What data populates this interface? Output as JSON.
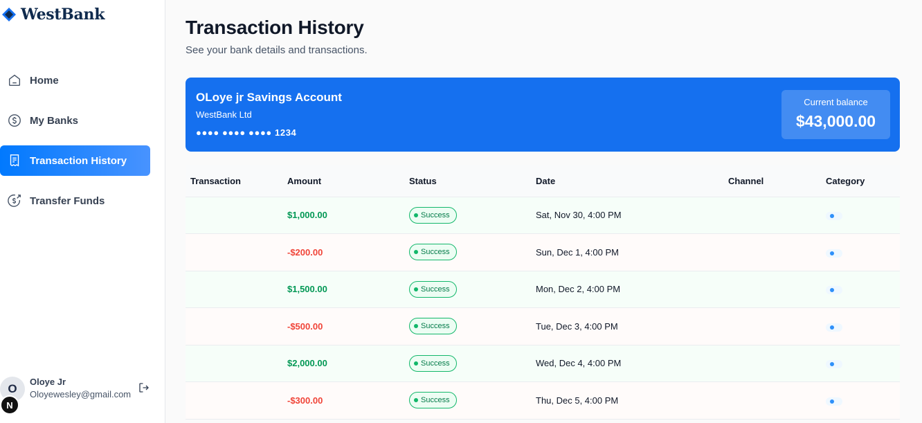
{
  "brand": {
    "name": "WestBank",
    "color": "#0f2a4d"
  },
  "sidebar": {
    "items": [
      {
        "label": "Home",
        "icon": "home-icon",
        "active": false
      },
      {
        "label": "My Banks",
        "icon": "dollar-circle-icon",
        "active": false
      },
      {
        "label": "Transaction History",
        "icon": "receipt-icon",
        "active": true
      },
      {
        "label": "Transfer Funds",
        "icon": "money-send-icon",
        "active": false
      }
    ],
    "user": {
      "initial": "O",
      "badge": "N",
      "name": "Oloye Jr",
      "email": "Oloyewesley@gmail.com"
    }
  },
  "header": {
    "title": "Transaction History",
    "subtitle": "See your bank details and transactions."
  },
  "account": {
    "name": "OLoye jr Savings Account",
    "bank": "WestBank Ltd",
    "mask": "●●●● ●●●● ●●●● 1234",
    "balance_label": "Current balance",
    "balance": "$43,000.00",
    "color": "#1570ef"
  },
  "table": {
    "headers": {
      "transaction": "Transaction",
      "amount": "Amount",
      "status": "Status",
      "date": "Date",
      "channel": "Channel",
      "category": "Category"
    },
    "rows": [
      {
        "transaction": "",
        "amount": "$1,000.00",
        "type": "credit",
        "status": "Success",
        "date": "Sat, Nov 30, 4:00 PM",
        "channel": ""
      },
      {
        "transaction": "",
        "amount": "-$200.00",
        "type": "debit",
        "status": "Success",
        "date": "Sun, Dec 1, 4:00 PM",
        "channel": ""
      },
      {
        "transaction": "",
        "amount": "$1,500.00",
        "type": "credit",
        "status": "Success",
        "date": "Mon, Dec 2, 4:00 PM",
        "channel": ""
      },
      {
        "transaction": "",
        "amount": "-$500.00",
        "type": "debit",
        "status": "Success",
        "date": "Tue, Dec 3, 4:00 PM",
        "channel": ""
      },
      {
        "transaction": "",
        "amount": "$2,000.00",
        "type": "credit",
        "status": "Success",
        "date": "Wed, Dec 4, 4:00 PM",
        "channel": ""
      },
      {
        "transaction": "",
        "amount": "-$300.00",
        "type": "debit",
        "status": "Success",
        "date": "Thu, Dec 5, 4:00 PM",
        "channel": ""
      }
    ]
  },
  "colors": {
    "accent": "#0179fe",
    "credit": "#039855",
    "debit": "#f04438",
    "success": "#12b76a"
  }
}
